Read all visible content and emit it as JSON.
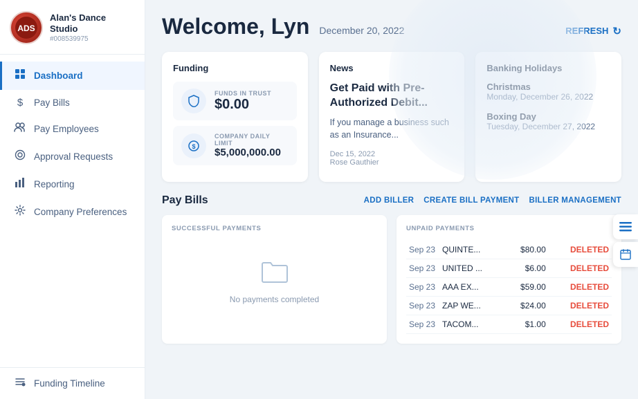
{
  "company": {
    "name": "Alan's Dance Studio",
    "id": "#008539975",
    "logo_text": "A"
  },
  "sidebar": {
    "items": [
      {
        "id": "dashboard",
        "label": "Dashboard",
        "icon": "⊞",
        "active": true
      },
      {
        "id": "pay-bills",
        "label": "Pay Bills",
        "icon": "$",
        "active": false
      },
      {
        "id": "pay-employees",
        "label": "Pay Employees",
        "icon": "👥",
        "active": false
      },
      {
        "id": "approval-requests",
        "label": "Approval Requests",
        "icon": "◎",
        "active": false
      },
      {
        "id": "reporting",
        "label": "Reporting",
        "icon": "📊",
        "active": false
      },
      {
        "id": "company-preferences",
        "label": "Company Preferences",
        "icon": "⚙",
        "active": false
      }
    ],
    "footer_items": [
      {
        "id": "funding-timeline",
        "label": "Funding Timeline",
        "icon": "⚙"
      }
    ]
  },
  "header": {
    "welcome": "Welcome, Lyn",
    "date": "December 20, 2022",
    "refresh_label": "REFRESH"
  },
  "funding": {
    "title": "Funding",
    "trust_label": "FUNDS IN TRUST",
    "trust_amount": "$0.00",
    "daily_label": "COMPANY DAILY LIMIT",
    "daily_amount": "$5,000,000.00"
  },
  "news": {
    "title": "News",
    "article_title": "Get Paid with Pre-Authorized Debit...",
    "article_desc": "If you manage a business such as an Insurance...",
    "article_date": "Dec 15, 2022",
    "article_author": "Rose Gauthier"
  },
  "banking_holidays": {
    "title": "Banking Holidays",
    "holidays": [
      {
        "name": "Christmas",
        "date": "Monday, December 26, 2022"
      },
      {
        "name": "Boxing Day",
        "date": "Tuesday, December 27, 2022"
      }
    ]
  },
  "pay_bills": {
    "title": "Pay Bills",
    "actions": [
      "ADD BILLER",
      "CREATE BILL PAYMENT",
      "BILLER MANAGEMENT"
    ],
    "successful_label": "SUCCESSFUL PAYMENTS",
    "empty_text": "No payments completed",
    "unpaid_label": "UNPAID PAYMENTS",
    "unpaid_rows": [
      {
        "date": "Sep 23",
        "name": "QUINTE...",
        "amount": "$80.00",
        "status": "DELETED"
      },
      {
        "date": "Sep 23",
        "name": "UNITED ...",
        "amount": "$6.00",
        "status": "DELETED"
      },
      {
        "date": "Sep 23",
        "name": "AAA EX...",
        "amount": "$59.00",
        "status": "DELETED"
      },
      {
        "date": "Sep 23",
        "name": "ZAP WE...",
        "amount": "$24.00",
        "status": "DELETED"
      },
      {
        "date": "Sep 23",
        "name": "TACOM...",
        "amount": "$1.00",
        "status": "DELETED"
      }
    ]
  }
}
